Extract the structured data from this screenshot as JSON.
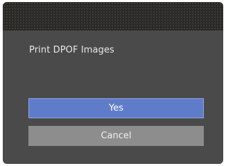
{
  "dialog": {
    "title": "Print DPOF Images",
    "options": {
      "yes_label": "Yes",
      "cancel_label": "Cancel"
    },
    "selected": "Yes"
  },
  "colors": {
    "selected_button": "#5f7ccb",
    "normal_button": "#8d8d8d",
    "background": "#4a4a4a"
  }
}
